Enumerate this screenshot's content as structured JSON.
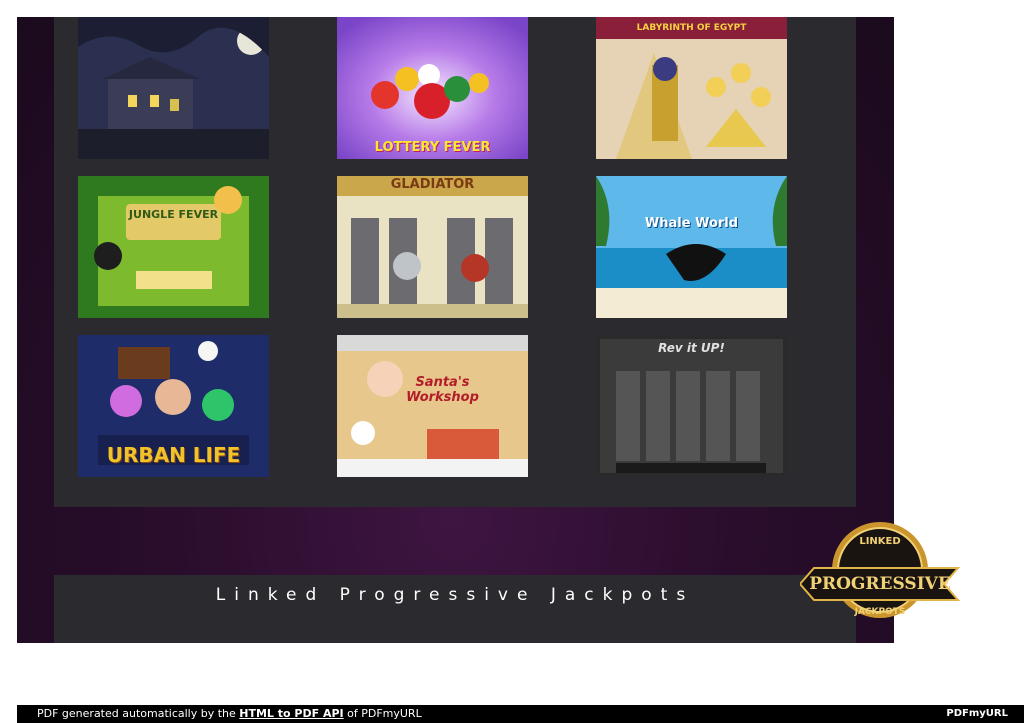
{
  "games": [
    {
      "id": "haunted-house",
      "title": ""
    },
    {
      "id": "lottery-fever",
      "title": "LOTTERY FEVER"
    },
    {
      "id": "labyrinth-of-egypt",
      "title": "LABYRINTH OF EGYPT"
    },
    {
      "id": "jungle-fever",
      "title": "JUNGLE FEVER"
    },
    {
      "id": "gladiator",
      "title": "GLADIATOR"
    },
    {
      "id": "whale-world",
      "title": "Whale World"
    },
    {
      "id": "urban-life",
      "title": "URBAN LIFE"
    },
    {
      "id": "santas-workshop",
      "title": "Santa's Workshop"
    },
    {
      "id": "rev-it-up",
      "title": "Rev it UP!"
    }
  ],
  "jackpot": {
    "title": "Linked Progressive Jackpots",
    "badge_top": "LINKED",
    "badge_main": "PROGRESSIVE",
    "badge_bottom": "JACKPOTS"
  },
  "footer": {
    "prefix": "PDF generated automatically by the ",
    "link": "HTML to PDF API",
    "suffix": " of PDFmyURL",
    "logo": "PDFmyURL"
  },
  "colors": {
    "page_bg": "#2a0d2c",
    "panel_bg": "#2b2a2e",
    "badge_gold": "#d4a73a"
  }
}
